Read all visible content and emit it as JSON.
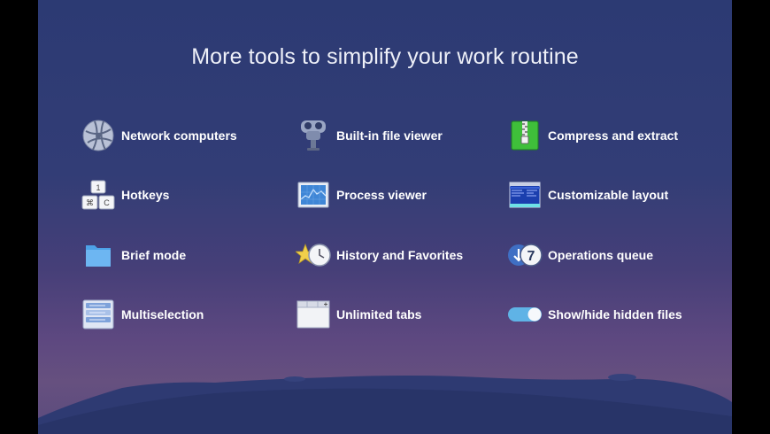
{
  "title": "More tools to simplify your work routine",
  "features": [
    {
      "label": "Network computers",
      "icon": "network-globe-icon"
    },
    {
      "label": "Built-in file viewer",
      "icon": "binocular-viewer-icon"
    },
    {
      "label": "Compress and extract",
      "icon": "zip-archive-icon"
    },
    {
      "label": "Hotkeys",
      "icon": "keyboard-keys-icon"
    },
    {
      "label": "Process viewer",
      "icon": "process-monitor-icon"
    },
    {
      "label": "Customizable layout",
      "icon": "layout-window-icon"
    },
    {
      "label": "Brief mode",
      "icon": "folder-icon"
    },
    {
      "label": "History and Favorites",
      "icon": "star-clock-icon"
    },
    {
      "label": "Operations queue",
      "icon": "download-queue-icon"
    },
    {
      "label": "Multiselection",
      "icon": "multiselect-list-icon"
    },
    {
      "label": "Unlimited tabs",
      "icon": "tabs-window-icon"
    },
    {
      "label": "Show/hide hidden files",
      "icon": "toggle-switch-icon"
    }
  ],
  "hotkey_glyphs": {
    "top": "1",
    "left": "⌘",
    "right": "C"
  },
  "queue_number": "7",
  "colors": {
    "background_top": "#2c3a73",
    "background_bottom": "#66507f",
    "ground": "#2e3a72",
    "toggle_on": "#5fb3e6",
    "zip_green": "#3fbf3a"
  }
}
